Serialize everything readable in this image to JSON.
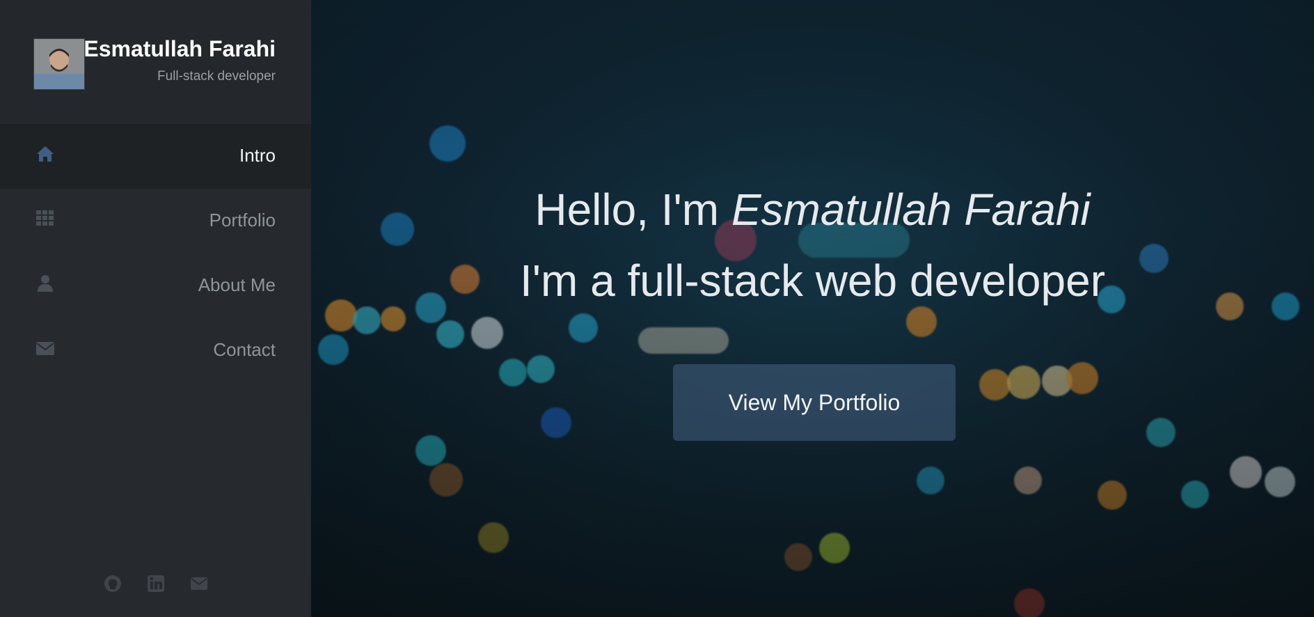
{
  "profile": {
    "name": "Esmatullah Farahi",
    "role": "Full-stack developer"
  },
  "nav": {
    "items": [
      {
        "label": "Intro",
        "icon": "home-icon",
        "active": true
      },
      {
        "label": "Portfolio",
        "icon": "grid-icon",
        "active": false
      },
      {
        "label": "About Me",
        "icon": "user-icon",
        "active": false
      },
      {
        "label": "Contact",
        "icon": "envelope-icon",
        "active": false
      }
    ]
  },
  "social": [
    "github-icon",
    "linkedin-icon",
    "envelope-icon"
  ],
  "hero": {
    "greeting": "Hello, I'm ",
    "name": "Esmatullah Farahi",
    "subtitle": "I'm a full-stack web developer",
    "cta_label": "View My Portfolio"
  },
  "colors": {
    "sidebar_bg": "#262a2e",
    "active_item_bg": "#1f2225",
    "active_icon": "#3f5f86",
    "inactive_icon": "#4a5057",
    "cta_bg": "#466082"
  }
}
